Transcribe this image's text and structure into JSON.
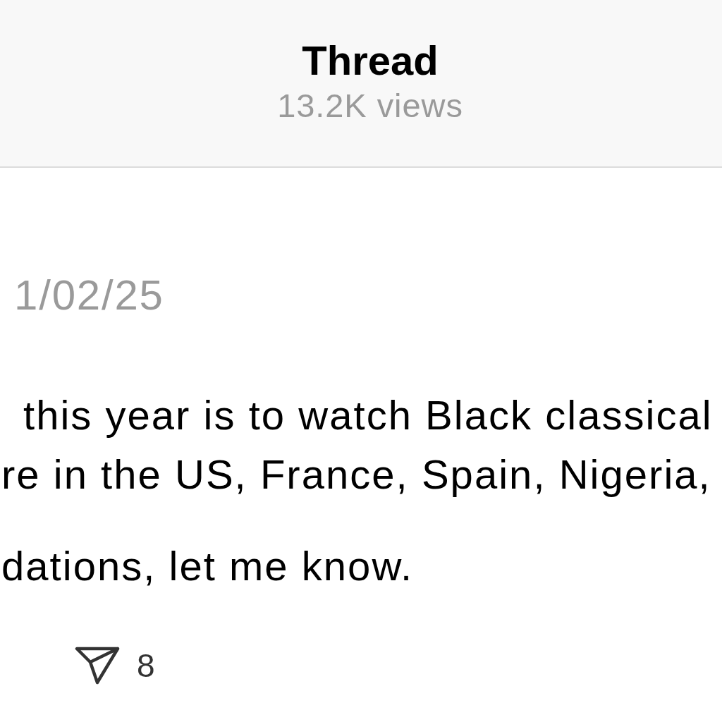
{
  "header": {
    "title": "Thread",
    "views": "13.2K views"
  },
  "post": {
    "date": "1/02/25",
    "paragraphs": [
      [
        "this year is to watch Black classical",
        "re in the US, France, Spain, Nigeria,"
      ],
      [
        "dations, let me know."
      ]
    ],
    "share_count": "8"
  }
}
